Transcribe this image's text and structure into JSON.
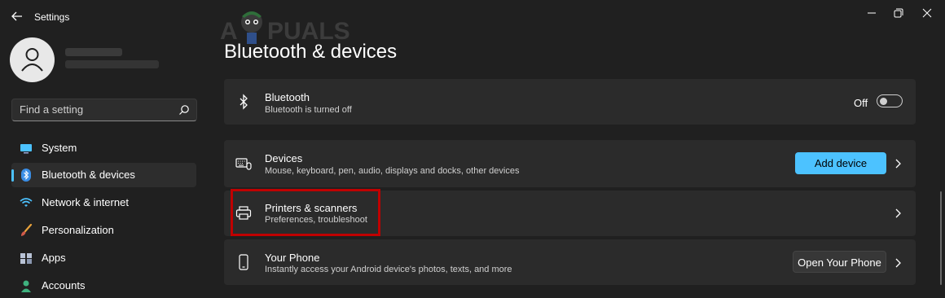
{
  "app": {
    "title": "Settings"
  },
  "watermark": {
    "text": "APPUALS"
  },
  "search": {
    "placeholder": "Find a setting"
  },
  "sidebar": {
    "items": [
      {
        "label": "System",
        "icon": "monitor-icon"
      },
      {
        "label": "Bluetooth & devices",
        "icon": "bluetooth-icon",
        "active": true
      },
      {
        "label": "Network & internet",
        "icon": "wifi-icon"
      },
      {
        "label": "Personalization",
        "icon": "brush-icon"
      },
      {
        "label": "Apps",
        "icon": "apps-icon"
      },
      {
        "label": "Accounts",
        "icon": "person-icon"
      }
    ]
  },
  "main": {
    "title": "Bluetooth & devices",
    "bluetooth": {
      "title": "Bluetooth",
      "subtitle": "Bluetooth is turned off",
      "toggle_label": "Off",
      "enabled": false
    },
    "devices": {
      "title": "Devices",
      "subtitle": "Mouse, keyboard, pen, audio, displays and docks, other devices",
      "button": "Add device"
    },
    "printers": {
      "title": "Printers & scanners",
      "subtitle": "Preferences, troubleshoot"
    },
    "phone": {
      "title": "Your Phone",
      "subtitle": "Instantly access your Android device's photos, texts, and more",
      "button": "Open Your Phone"
    }
  },
  "colors": {
    "accent": "#4cc2ff",
    "background": "#202020",
    "card": "#2b2b2b",
    "highlight": "#c00000"
  }
}
